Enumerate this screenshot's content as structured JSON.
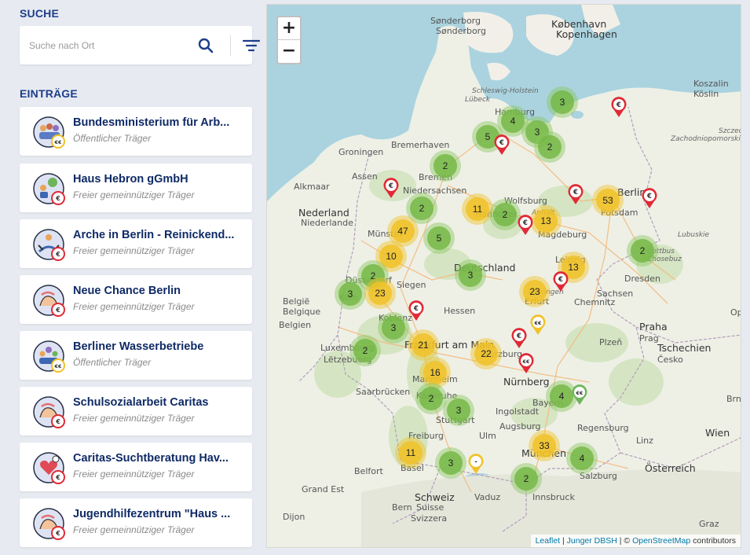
{
  "search": {
    "title": "SUCHE",
    "placeholder": "Suche nach Ort"
  },
  "entries_title": "EINTRÄGE",
  "entries": [
    {
      "name": "Bundesministerium für Arb...",
      "type": "Öffentlicher Träger",
      "badge": "€€",
      "badge_color": "#f0c228"
    },
    {
      "name": "Haus Hebron gGmbH",
      "type": "Freier gemeinnütziger Träger",
      "badge": "€",
      "badge_color": "#e02a36"
    },
    {
      "name": "Arche in Berlin - Reinickend...",
      "type": "Freier gemeinnütziger Träger",
      "badge": "€",
      "badge_color": "#e02a36"
    },
    {
      "name": "Neue Chance Berlin",
      "type": "Freier gemeinnütziger Träger",
      "badge": "€",
      "badge_color": "#e02a36"
    },
    {
      "name": "Berliner Wasserbetriebe",
      "type": "Öffentlicher Träger",
      "badge": "€€",
      "badge_color": "#f0c228"
    },
    {
      "name": "Schulsozialarbeit Caritas",
      "type": "Freier gemeinnütziger Träger",
      "badge": "€",
      "badge_color": "#e02a36"
    },
    {
      "name": "Caritas-Suchtberatung Hav...",
      "type": "Freier gemeinnütziger Träger",
      "badge": "€",
      "badge_color": "#e02a36"
    },
    {
      "name": "Jugendhilfezentrum \"Haus ...",
      "type": "Freier gemeinnütziger Träger",
      "badge": "€",
      "badge_color": "#e02a36"
    }
  ],
  "map": {
    "zoom_in": "+",
    "zoom_out": "−",
    "clusters": [
      "3",
      "4",
      "5",
      "2",
      "3",
      "2",
      "2",
      "53",
      "2",
      "47",
      "11",
      "2",
      "13",
      "5",
      "10",
      "2",
      "3",
      "13",
      "3",
      "23",
      "23",
      "3",
      "21",
      "2",
      "22",
      "16",
      "2",
      "3",
      "4",
      "11",
      "3",
      "33",
      "4",
      "2"
    ],
    "pins": [
      "€",
      "€",
      "€",
      "€",
      "€",
      "€",
      "€",
      "€",
      "€",
      "€€",
      "€€",
      "€€",
      "-"
    ],
    "labels": [
      "København",
      "Kopenhagen",
      "Sønderborg",
      "Sønderborg",
      "Schleswig-Holstein",
      "Lübeck",
      "Hamburg",
      "Bremerhaven",
      "Groningen",
      "Bremen",
      "Assen",
      "Alkmaar",
      "Niedersachsen",
      "Nederland",
      "Niederlande",
      "Wolfsburg",
      "Hannover",
      "Berlin",
      "Potsdam",
      "Münster",
      "Magdeburg",
      "Anhalt",
      "Leipzig",
      "Deutschland",
      "Sachsen",
      "Dresden",
      "Chemnitz",
      "Thüringen",
      "Erfurt",
      "Düsseldorf",
      "Köln",
      "Siegen",
      "Hessen",
      "België",
      "Belgique",
      "Belgien",
      "Koblenz",
      "Frankfurt am Main",
      "Luxembourg",
      "Lëtzebuerg",
      "Mannheim",
      "Würzburg",
      "Nürnberg",
      "Bayern",
      "Regensburg",
      "Praha",
      "Prag",
      "Tschechien",
      "Česko",
      "Plzeň",
      "Karlsruhe",
      "Saarbrücken",
      "Stuttgart",
      "Ingolstadt",
      "Augsburg",
      "Ulm",
      "München",
      "Freiburg",
      "Basel",
      "Belfort",
      "Salzburg",
      "Österreich",
      "Wien",
      "Schweiz",
      "Suisse",
      "Svizzera",
      "Bern",
      "Vaduz",
      "Innsbruck",
      "Koszalin",
      "Köslin",
      "Zachodniopomorskie",
      "Lubuskie",
      "Chosebuz",
      "Cottbus",
      "Szczecin",
      "Opole",
      "Brno",
      "Linz",
      "Graz",
      "Dijon",
      "Grand Est"
    ],
    "attribution": {
      "leaflet": "Leaflet",
      "sep1": " | ",
      "source": "Junger DBSH",
      "sep2": " | © ",
      "osm": "OpenStreetMap",
      "suffix": " contributors"
    }
  }
}
